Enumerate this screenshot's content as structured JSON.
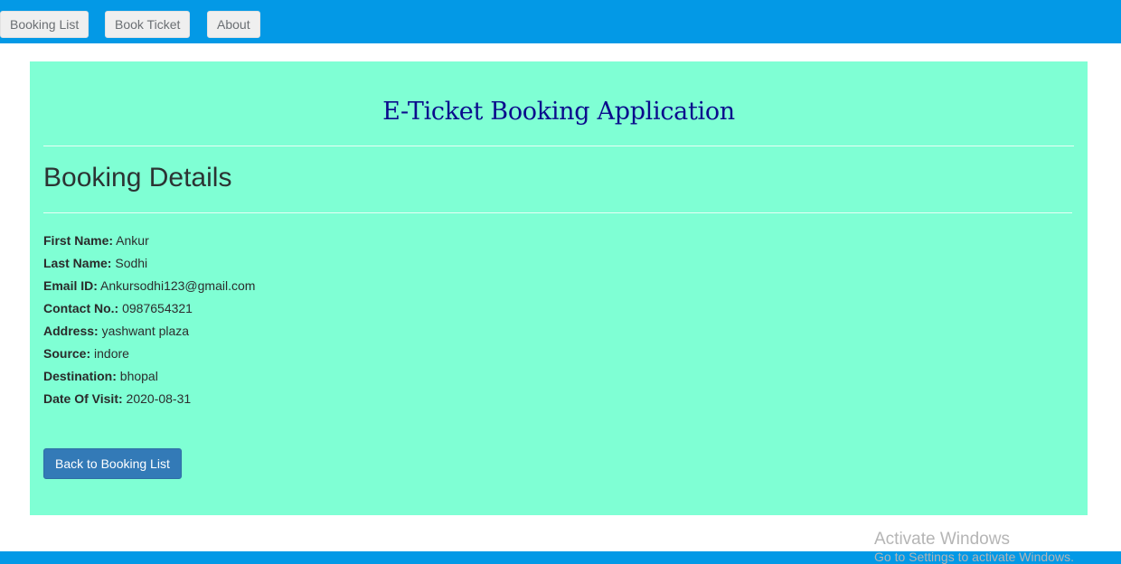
{
  "nav": {
    "booking_list": "Booking List",
    "book_ticket": "Book Ticket",
    "about": "About"
  },
  "app_title": "E-Ticket Booking Application",
  "section_title": "Booking Details",
  "details": [
    {
      "label": "First Name:",
      "value": "Ankur"
    },
    {
      "label": "Last Name:",
      "value": "Sodhi"
    },
    {
      "label": "Email ID:",
      "value": "Ankursodhi123@gmail.com"
    },
    {
      "label": "Contact No.:",
      "value": "0987654321"
    },
    {
      "label": "Address:",
      "value": "yashwant plaza"
    },
    {
      "label": "Source:",
      "value": "indore"
    },
    {
      "label": "Destination:",
      "value": "bhopal"
    },
    {
      "label": "Date Of Visit:",
      "value": "2020-08-31"
    }
  ],
  "back_button": "Back to Booking List",
  "watermark": {
    "line1": "Activate Windows",
    "line2": "Go to Settings to activate Windows."
  },
  "colors": {
    "nav_bar": "#0399e6",
    "panel_bg": "#7fffd4",
    "title": "#0b0b8c",
    "primary_button": "#337ab7"
  }
}
